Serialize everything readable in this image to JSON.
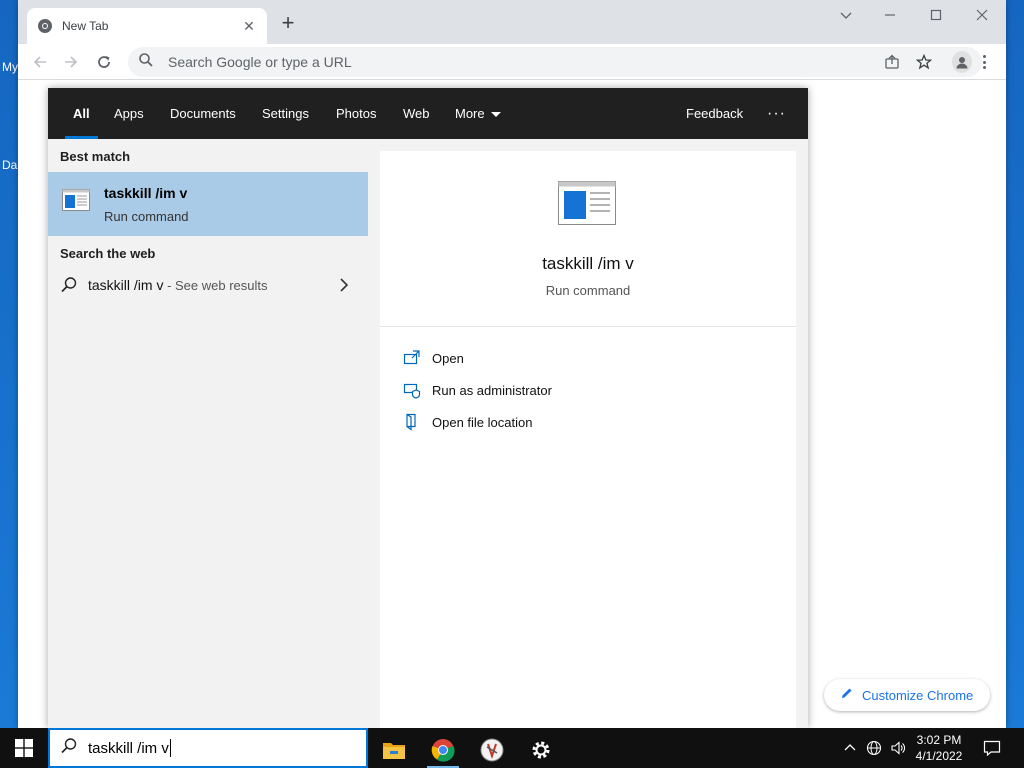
{
  "desktop": {
    "icon_labels": [
      "My",
      "Da"
    ]
  },
  "browser": {
    "tab_title": "New Tab",
    "new_tab_symbol": "+",
    "omnibox_placeholder": "Search Google or type a URL",
    "customize_label": "Customize Chrome"
  },
  "search": {
    "tabs": [
      "All",
      "Apps",
      "Documents",
      "Settings",
      "Photos",
      "Web",
      "More"
    ],
    "active_tab": "All",
    "feedback_label": "Feedback",
    "more_options": "···",
    "best_match_label": "Best match",
    "best_match": {
      "name": "taskkill /im v",
      "type": "Run command"
    },
    "search_web_label": "Search the web",
    "web_result": {
      "query": "taskkill /im v",
      "suffix": " - See web results"
    },
    "preview": {
      "name": "taskkill /im v",
      "type": "Run command"
    },
    "actions": [
      {
        "label": "Open",
        "icon": "open-icon"
      },
      {
        "label": "Run as administrator",
        "icon": "shield-icon"
      },
      {
        "label": "Open file location",
        "icon": "file-location-icon"
      }
    ],
    "query_value": "taskkill /im v"
  },
  "taskbar": {
    "apps": [
      "file-explorer-icon",
      "chrome-icon",
      "app-icon",
      "settings-icon"
    ],
    "time": "3:02 PM",
    "date": "4/1/2022"
  },
  "colors": {
    "accent": "#0078d7",
    "highlight": "#a9cbe8",
    "chrome_link": "#1a73e8"
  }
}
